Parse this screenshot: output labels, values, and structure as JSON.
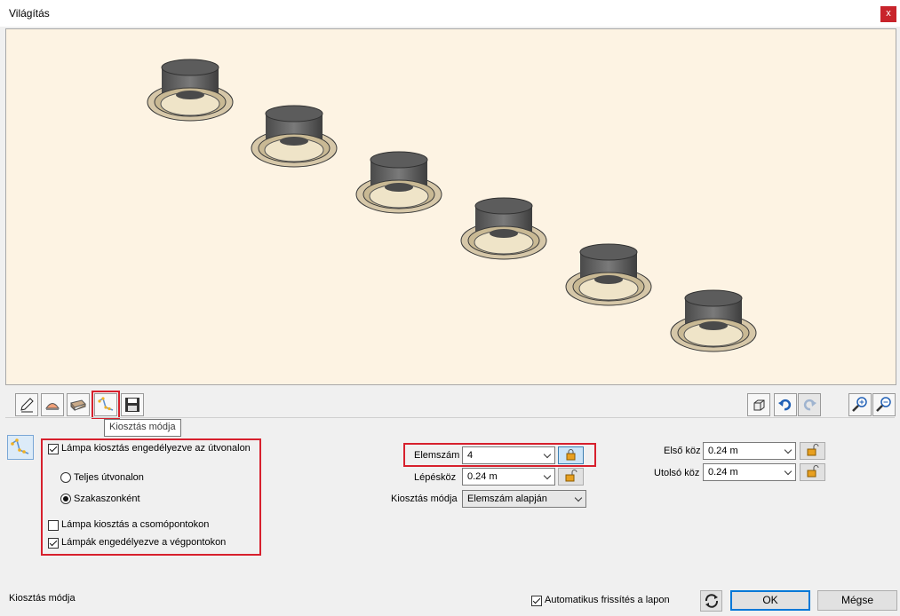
{
  "window": {
    "title": "Világítás",
    "close_label": "x"
  },
  "toolbar": {
    "tabs": [
      {
        "icon": "pencil-icon"
      },
      {
        "icon": "lamp-icon"
      },
      {
        "icon": "material-icon"
      },
      {
        "icon": "distribution-path-icon"
      },
      {
        "icon": "save-icon"
      }
    ],
    "tooltip": "Kiosztás módja",
    "right_icons": [
      "box-view-icon",
      "undo-icon",
      "redo-icon",
      "zoom-in-icon",
      "zoom-out-icon"
    ]
  },
  "options": {
    "enable_path": "Lámpa kiosztás engedélyezve az útvonalon",
    "full_path": "Teljes útvonalon",
    "by_segment": "Szakaszonként",
    "at_nodes": "Lámpa kiosztás a csomópontokon",
    "at_endpoints": "Lámpák engedélyezve a végpontokon"
  },
  "fields": {
    "elemszam_label": "Elemszám",
    "elemszam_value": "4",
    "lepeskoz_label": "Lépésköz",
    "lepeskoz_value": "0.24 m",
    "mode_label": "Kiosztás módja",
    "mode_value": "Elemszám alapján",
    "first_label": "Első köz",
    "first_value": "0.24 m",
    "last_label": "Utolsó köz",
    "last_value": "0.24 m"
  },
  "footer": {
    "status": "Kiosztás módja",
    "auto_refresh": "Automatikus frissítés a lapon",
    "ok": "OK",
    "cancel": "Mégse"
  },
  "colors": {
    "accent_red": "#d7202d",
    "viewport_bg": "#fdf3e3",
    "primary_blue": "#0078d7"
  }
}
